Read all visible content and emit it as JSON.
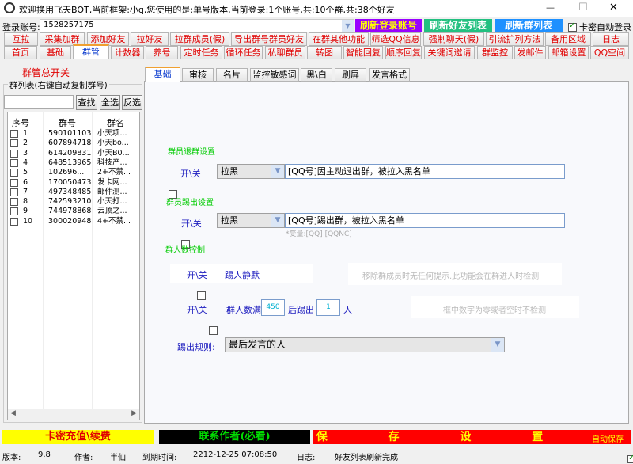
{
  "window": {
    "title": "欢迎换用飞天BOT,当前框架:小q,您使用的是:单号版本,当前登录:1个账号,共:10个群,共:38个好友",
    "minimize": "—",
    "maximize": "☐",
    "close": "✕"
  },
  "login": {
    "label": "登录账号:",
    "value": "1528257175",
    "refresh_login": "刷新登录账号",
    "refresh_friends": "刷新好友列表",
    "refresh_groups": "刷新群列表",
    "auto_login": "卡密自动登录",
    "auto_login_checked": true
  },
  "tabs_row1": [
    "互拉",
    "采集加群",
    "添加好友",
    "拉好友",
    "拉群成员(假)",
    "导出群号群员好友",
    "在群其他功能",
    "筛选QQ信息",
    "强制聊天(假)",
    "引流扩列方法",
    "备用区域",
    "日志"
  ],
  "tabs_row2": [
    "首页",
    "基础",
    "群管",
    "计数器",
    "养号",
    "定时任务",
    "循环任务",
    "私聊群员",
    "转图",
    "智能回复",
    "顺序回复",
    "关键词邀请",
    "群监控",
    "发邮件",
    "邮箱设置",
    "QQ空间"
  ],
  "active_tab": "群管",
  "left": {
    "master_switch": "群管总开关",
    "group_title": "群列表(右键自动复制群号)",
    "search_placeholder": "",
    "find": "查找",
    "select_all": "全选",
    "invert": "反选",
    "columns": [
      "序号",
      "群号",
      "群名"
    ],
    "rows": [
      [
        "1",
        "590101103",
        "小天项..."
      ],
      [
        "2",
        "607894718",
        "小天bo..."
      ],
      [
        "3",
        "614209831",
        "小天B0..."
      ],
      [
        "4",
        "648513965",
        "科技产..."
      ],
      [
        "5",
        "102696...",
        "2+不禁..."
      ],
      [
        "6",
        "170050473",
        "发卡网..."
      ],
      [
        "7",
        "497348485",
        "邮件测..."
      ],
      [
        "8",
        "742593210",
        "小天打..."
      ],
      [
        "9",
        "744978868",
        "云顶之..."
      ],
      [
        "10",
        "300020948",
        "4+不禁..."
      ]
    ]
  },
  "inner_tabs": [
    "基础",
    "审核",
    "名片",
    "监控敏感词",
    "黑\\白",
    "刷屏",
    "发言格式"
  ],
  "active_inner_tab": "基础",
  "form": {
    "quit_title": "群员退群设置",
    "onoff": "开\\关",
    "quit_action": "拉黑",
    "quit_msg": "[QQ号]因主动退出群，被拉入黑名单",
    "kick_title": "群员踢出设置",
    "kick_action": "拉黑",
    "kick_msg": "[QQ号]踢出群，被拉入黑名单",
    "vars_hint": "*变量:[QQ] [QQNC]",
    "count_title": "群人数控制",
    "silent_kick": "踢人静默",
    "silent_hint": "移除群成员时无任何提示.此功能会在群进人时检测",
    "full_label": "群人数满",
    "full_value": "450",
    "after_kick": "后踢出",
    "kick_count": "1",
    "person": "人",
    "zero_hint": "框中数字为零或者空时不检测",
    "rule_label": "踢出规则:",
    "rule_value": "最后发言的人"
  },
  "bottom": {
    "recharge": "卡密充值\\续费",
    "contact": "联系作者(必看)",
    "save": "保 存 设 置",
    "auto_save": "自动保存",
    "auto_save_checked": true
  },
  "status": {
    "version_label": "版本:",
    "version": "9.8",
    "author_label": "作者:",
    "author": "半仙",
    "expire_label": "到期时间:",
    "expire": "2212-12-25 07:08:50",
    "log_label": "日志:",
    "log": "好友列表刷新完成"
  },
  "colors": {
    "tab_text": "#e00000",
    "login_btn": "#9900ff",
    "friends_btn": "#22c080",
    "groups_btn": "#1e90ff",
    "recharge_bg": "#ffff00",
    "contact_bg": "#000000",
    "save_bg": "#ff0000"
  }
}
